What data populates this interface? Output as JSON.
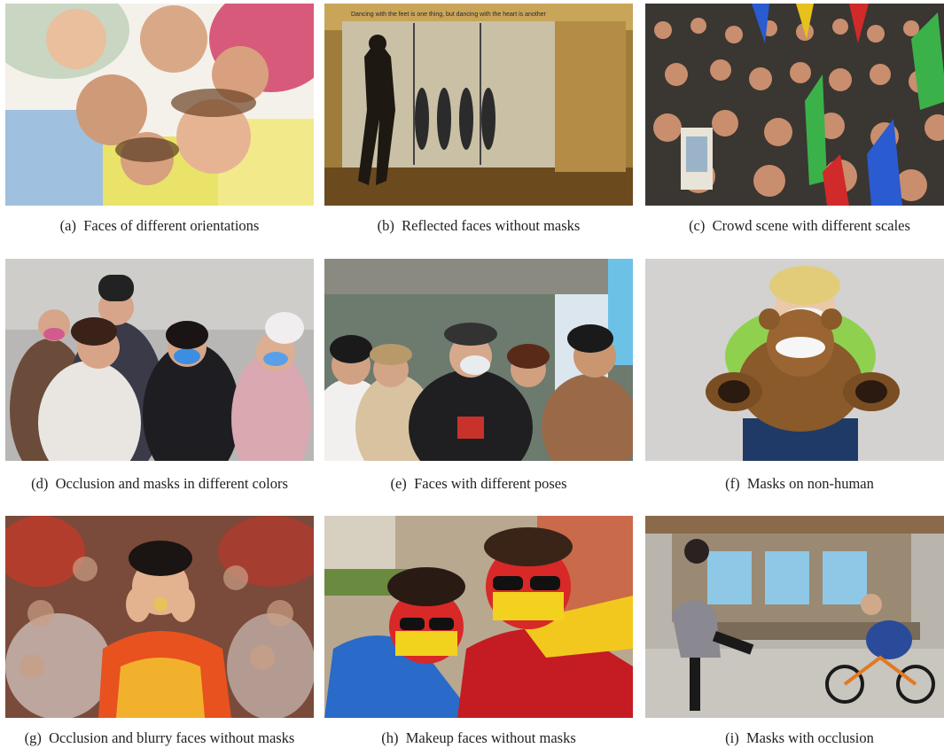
{
  "figure": {
    "panels": [
      {
        "label": "(a)",
        "caption": "Faces of different orientations",
        "image": "photo-family-looking-down"
      },
      {
        "label": "(b)",
        "caption": "Reflected faces without masks",
        "image": "photo-dance-studio-mirror",
        "overlay_text": "Dancing with the feet is one thing, but dancing with the heart is another"
      },
      {
        "label": "(c)",
        "caption": "Crowd scene with different scales",
        "image": "photo-crowd-with-flags"
      },
      {
        "label": "(d)",
        "caption": "Occlusion and masks in different colors",
        "image": "photo-people-with-face-masks"
      },
      {
        "label": "(e)",
        "caption": "Faces with different poses",
        "image": "photo-street-crowd"
      },
      {
        "label": "(f)",
        "caption": "Masks on non-human",
        "image": "photo-girl-with-teddy-bear"
      },
      {
        "label": "(g)",
        "caption": "Occlusion and blurry faces without masks",
        "image": "photo-athlete-with-medal"
      },
      {
        "label": "(h)",
        "caption": "Makeup faces without masks",
        "image": "photo-fans-with-face-paint"
      },
      {
        "label": "(i)",
        "caption": "Masks with occlusion",
        "image": "photo-park-child-bicycle"
      }
    ]
  }
}
